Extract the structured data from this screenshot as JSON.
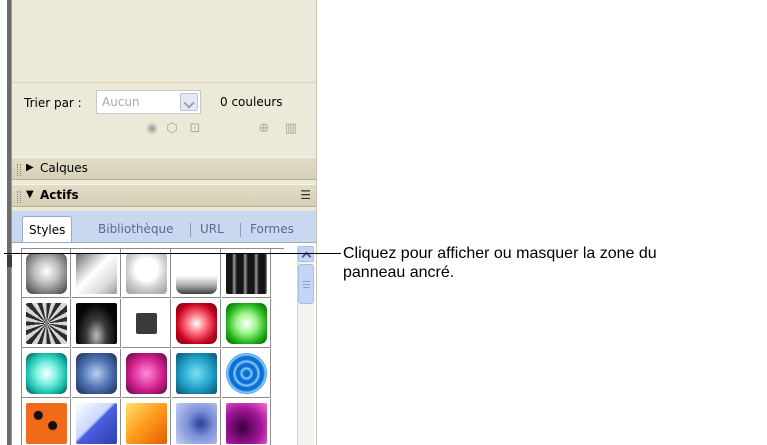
{
  "panel": {
    "sort_label": "Trier par :",
    "sort_select_value": "Aucun",
    "color_count": "0 couleurs",
    "tools": [
      "web-safe-icon",
      "cube-icon",
      "lock-icon",
      "add-color-icon",
      "trash-icon"
    ]
  },
  "groups": {
    "calques": {
      "label": "Calques",
      "expanded": false
    },
    "actifs": {
      "label": "Actifs",
      "expanded": true
    }
  },
  "tabs": [
    {
      "label": "Styles",
      "active": true
    },
    {
      "label": "Bibliothèque",
      "active": false
    },
    {
      "label": "URL",
      "active": false
    },
    {
      "label": "Formes",
      "active": false
    }
  ],
  "callout": {
    "text_line1": "Cliquez pour afficher ou masquer la zone du",
    "text_line2": "panneau ancré."
  },
  "colors": {
    "panel_bg": "#ece9d8",
    "tab_strip": "#c9d7f0",
    "dock_bar": "#6b6b6b"
  }
}
